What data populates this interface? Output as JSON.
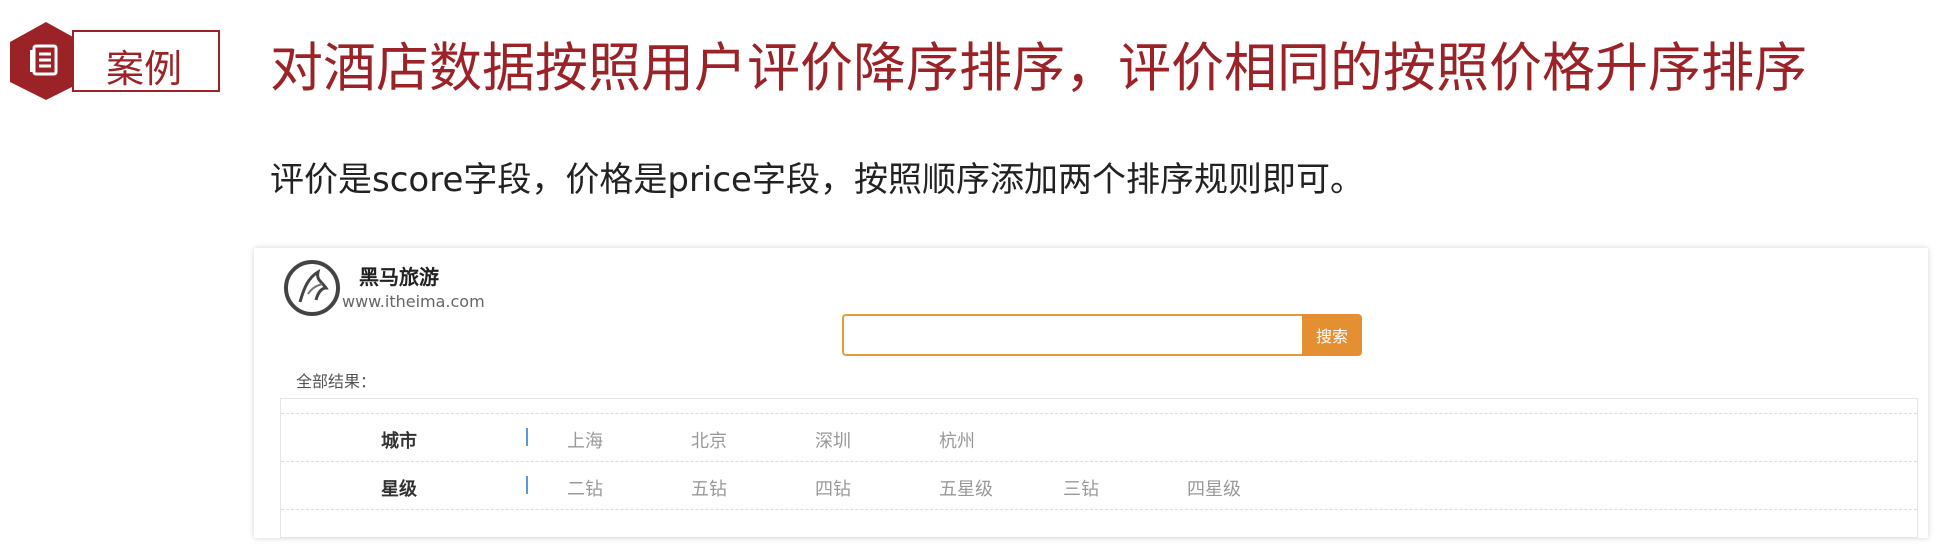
{
  "header": {
    "badge_label": "案例",
    "title": "对酒店数据按照用户评价降序排序，评价相同的按照价格升序排序"
  },
  "description": "评价是score字段，价格是price字段，按照顺序添加两个排序规则即可。",
  "screenshot": {
    "brand_name": "黑马旅游",
    "brand_url": "www.itheima.com",
    "search": {
      "value": "",
      "placeholder": "",
      "button_label": "搜索"
    },
    "all_results_label": "全部结果：",
    "filters": [
      {
        "label": "城市",
        "options": [
          "上海",
          "北京",
          "深圳",
          "杭州"
        ]
      },
      {
        "label": "星级",
        "options": [
          "二钻",
          "五钻",
          "四钻",
          "五星级",
          "三钻",
          "四星级"
        ]
      }
    ]
  },
  "colors": {
    "accent": "#9b2328",
    "search_button": "#e58f33",
    "filter_separator": "#5b9bd5"
  }
}
